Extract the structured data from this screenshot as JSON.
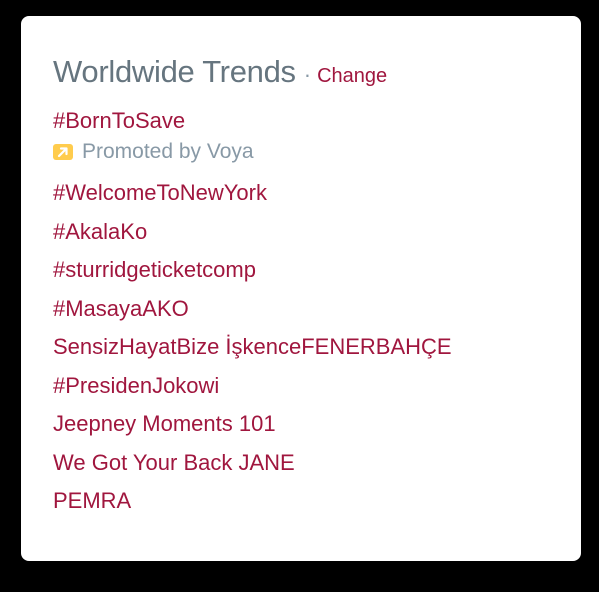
{
  "header": {
    "title": "Worldwide Trends",
    "separator": "·",
    "change_label": "Change"
  },
  "promoted_trend": {
    "label": "#BornToSave",
    "promoted_text": "Promoted by Voya",
    "icon": "promoted-arrow-icon",
    "icon_color": "#ffcc4d"
  },
  "trends": [
    "#WelcomeToNewYork",
    "#AkalaKo",
    "#sturridgeticketcomp",
    "#MasayaAKO",
    "SensizHayatBize İşkenceFENERBAHÇE",
    "#PresidenJokowi",
    "Jeepney Moments 101",
    "We Got Your Back JANE",
    "PEMRA"
  ],
  "colors": {
    "link": "#a0163e",
    "title": "#66757f",
    "muted": "#8899a6",
    "background": "#000000",
    "card": "#ffffff"
  }
}
